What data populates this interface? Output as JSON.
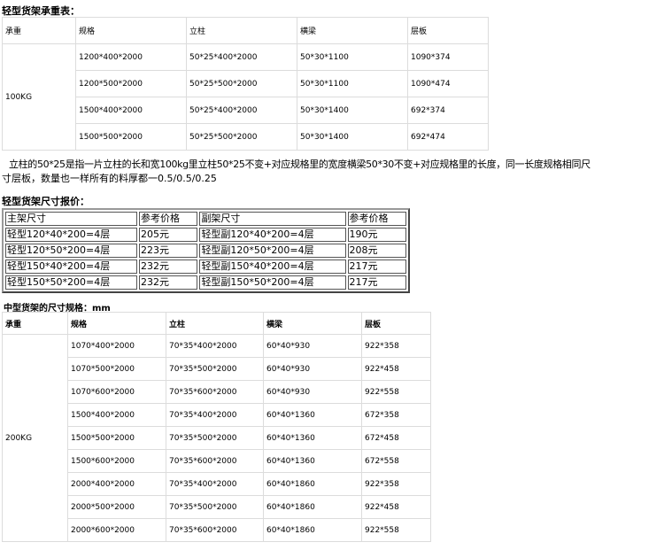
{
  "section1": {
    "title": "轻型货架承重表：",
    "headers": [
      "承重",
      "规格",
      "立柱",
      "横梁",
      "层板"
    ],
    "load": "100KG",
    "rows": [
      [
        "1200*400*2000",
        "50*25*400*2000",
        "50*30*1100",
        "1090*374"
      ],
      [
        "1200*500*2000",
        "50*25*500*2000",
        "50*30*1100",
        "1090*474"
      ],
      [
        "1500*400*2000",
        "50*25*400*2000",
        "50*30*1400",
        "692*374"
      ],
      [
        "1500*500*2000",
        "50*25*500*2000",
        "50*30*1400",
        "692*474"
      ]
    ]
  },
  "note": {
    "line1": "立柱的50*25是指一片立柱的长和宽100kg里立柱50*25不变+对应规格里的宽度横梁50*30不变+对应规格里的长度，同一长度规格相同尺",
    "line2": "寸层板，数量也一样所有的料厚都一0.5/0.5/0.25"
  },
  "section2": {
    "title": "轻型货架尺寸报价：",
    "headers": [
      "主架尺寸",
      "参考价格",
      "副架尺寸",
      "参考价格"
    ],
    "rows": [
      [
        "轻型120*40*200=4层",
        "205元",
        "轻型副120*40*200=4层",
        "190元"
      ],
      [
        "轻型120*50*200=4层",
        "223元",
        "轻型副120*50*200=4层",
        "208元"
      ],
      [
        "轻型150*40*200=4层",
        "232元",
        "轻型副150*40*200=4层",
        "217元"
      ],
      [
        "轻型150*50*200=4层",
        "232元",
        "轻型副150*50*200=4层",
        "217元"
      ]
    ]
  },
  "section3": {
    "title": "中型货架的尺寸规格：mm",
    "headers": [
      "承重",
      "规格",
      "立柱",
      "横梁",
      "层板"
    ],
    "load": "200KG",
    "rows": [
      [
        "1070*400*2000",
        "70*35*400*2000",
        "60*40*930",
        "922*358"
      ],
      [
        "1070*500*2000",
        "70*35*500*2000",
        "60*40*930",
        "922*458"
      ],
      [
        "1070*600*2000",
        "70*35*600*2000",
        "60*40*930",
        "922*558"
      ],
      [
        "1500*400*2000",
        "70*35*400*2000",
        "60*40*1360",
        "672*358"
      ],
      [
        "1500*500*2000",
        "70*35*500*2000",
        "60*40*1360",
        "672*458"
      ],
      [
        "1500*600*2000",
        "70*35*600*2000",
        "60*40*1360",
        "672*558"
      ],
      [
        "2000*400*2000",
        "70*35*400*2000",
        "60*40*1860",
        "922*358"
      ],
      [
        "2000*500*2000",
        "70*35*500*2000",
        "60*40*1860",
        "922*458"
      ],
      [
        "2000*600*2000",
        "70*35*600*2000",
        "60*40*1860",
        "922*558"
      ]
    ]
  }
}
